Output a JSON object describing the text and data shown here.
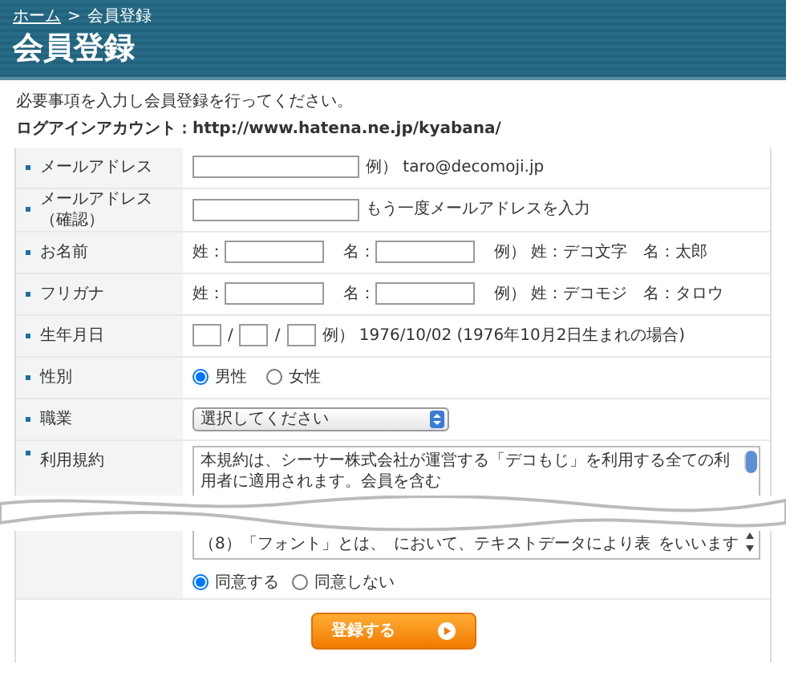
{
  "breadcrumb": [
    {
      "label": "ホーム",
      "kind": "link"
    },
    {
      "label": ">",
      "kind": "separator"
    },
    {
      "label": "会員登録",
      "kind": "current"
    }
  ],
  "title": "会員登録",
  "intro": "必要事項を入力し会員登録を行ってください。",
  "login_account": "ログアインアカウント：http://www.hatena.ne.jp/kyabana/",
  "fields": [
    {
      "label": "メールアドレス",
      "kind": "text",
      "hint": "例） taro@decomoji.jp"
    },
    {
      "label": "メールアドレス（確認）",
      "kind": "text",
      "hint": "もう一度メールアドレスを入力"
    },
    {
      "label": "お名前",
      "kind": "pair",
      "parts": [
        "姓：",
        "名："
      ],
      "hint": "例） 姓：デコ文字　名：太郎"
    },
    {
      "label": "フリガナ",
      "kind": "pair",
      "parts": [
        "姓：",
        "名："
      ],
      "hint": "例） 姓：デコモジ　名：タロウ"
    },
    {
      "label": "生年月日",
      "kind": "date",
      "separators": [
        "/",
        "/"
      ],
      "hint": "例） 1976/10/02 (1976年10月2日生まれの場合)"
    },
    {
      "label": "性別",
      "kind": "radio",
      "options": [
        {
          "label": "男性",
          "selected": true
        },
        {
          "label": "女性",
          "selected": false
        }
      ]
    },
    {
      "label": "職業",
      "kind": "select",
      "value": "選択してください"
    }
  ],
  "terms": {
    "label": "利用規約",
    "top_lines": [
      [
        "本規約は、シーサー株式会社が運営する「デコもじ」を利用する全ての利用者に適用されます。会員を含む"
      ]
    ],
    "bottom_lines": [
      [
        "（8）「フォント」とは、",
        "において、テキストデータにより表",
        "をいいます"
      ]
    ],
    "options": [
      {
        "label": "同意する",
        "selected": true
      },
      {
        "label": "同意しない",
        "selected": false
      }
    ]
  },
  "submit": "登録する"
}
